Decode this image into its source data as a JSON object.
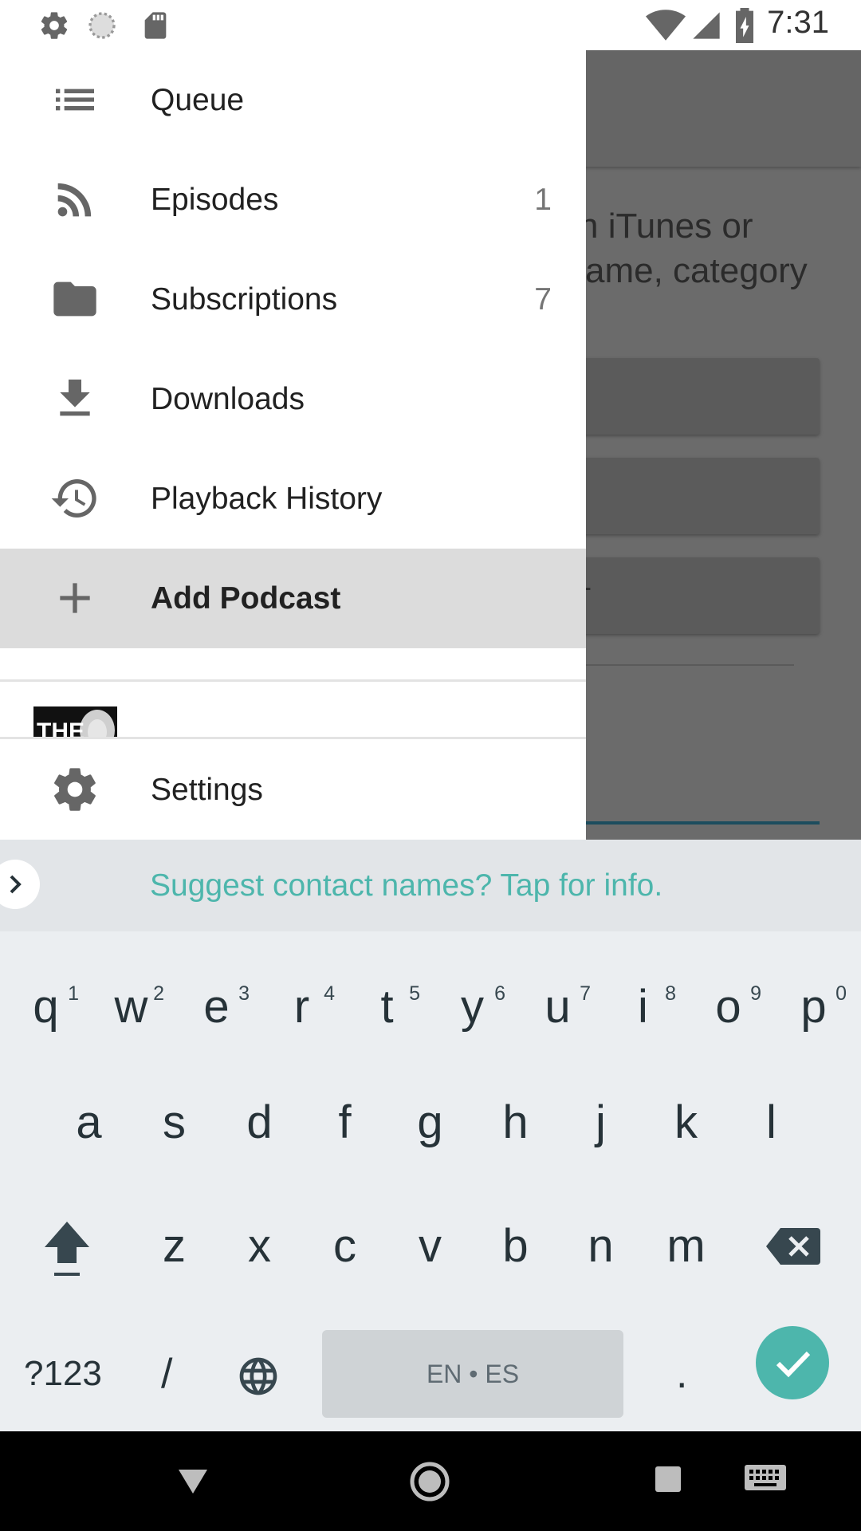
{
  "status_bar": {
    "time": "7:31",
    "left_icons": [
      "settings-icon",
      "sync-icon",
      "sd-card-icon"
    ],
    "right_icons": [
      "wifi-icon",
      "signal-icon",
      "battery-charging-icon"
    ]
  },
  "background_screen": {
    "text_line1": "n iTunes or",
    "text_line2": "ame, category",
    "button3_fragment": "-"
  },
  "drawer": {
    "items": [
      {
        "label": "Queue",
        "icon": "queue-list-icon",
        "count": ""
      },
      {
        "label": "Episodes",
        "icon": "rss-feed-icon",
        "count": "1"
      },
      {
        "label": "Subscriptions",
        "icon": "folder-icon",
        "count": "7"
      },
      {
        "label": "Downloads",
        "icon": "download-icon",
        "count": ""
      },
      {
        "label": "Playback History",
        "icon": "history-icon",
        "count": ""
      },
      {
        "label": "Add Podcast",
        "icon": "plus-icon",
        "count": ""
      }
    ],
    "active_index": 5,
    "podcast_thumb_text": "THE",
    "settings_label": "Settings"
  },
  "suggestion_strip": {
    "text": "Suggest contact names? Tap for info."
  },
  "keyboard": {
    "row1": [
      {
        "ch": "q",
        "hint": "1"
      },
      {
        "ch": "w",
        "hint": "2"
      },
      {
        "ch": "e",
        "hint": "3"
      },
      {
        "ch": "r",
        "hint": "4"
      },
      {
        "ch": "t",
        "hint": "5"
      },
      {
        "ch": "y",
        "hint": "6"
      },
      {
        "ch": "u",
        "hint": "7"
      },
      {
        "ch": "i",
        "hint": "8"
      },
      {
        "ch": "o",
        "hint": "9"
      },
      {
        "ch": "p",
        "hint": "0"
      }
    ],
    "row2": [
      "a",
      "s",
      "d",
      "f",
      "g",
      "h",
      "j",
      "k",
      "l"
    ],
    "row3": [
      "z",
      "x",
      "c",
      "v",
      "b",
      "n",
      "m"
    ],
    "symbols_key": "?123",
    "slash_key": "/",
    "space_label": "EN • ES",
    "period_key": "."
  },
  "colors": {
    "accent": "#4db6ac",
    "drawer_active": "#dcdcdc",
    "scrim": "#6b6b6b"
  }
}
